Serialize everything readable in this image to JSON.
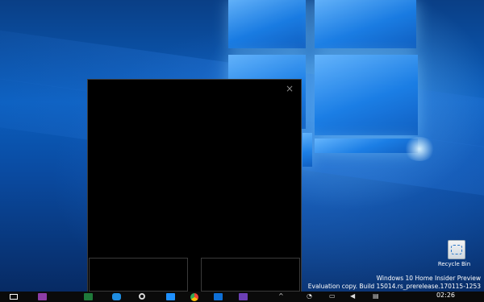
{
  "desktop": {
    "recycle_bin_label": "Recycle Bin",
    "watermark": {
      "line1": "Windows 10 Home Insider Preview",
      "line2": "Evaluation copy. Build 15014.rs_prerelease.170115-1253"
    }
  },
  "dialog": {
    "close_glyph": "×"
  },
  "taskbar": {
    "icons": [
      "windows-start-icon",
      "onenote-icon",
      "excel-icon",
      "skype-icon",
      "cortana-icon",
      "edge-icon",
      "chrome-icon",
      "skype-blue-icon",
      "visual-studio-icon"
    ],
    "clock_time": "02:26"
  }
}
